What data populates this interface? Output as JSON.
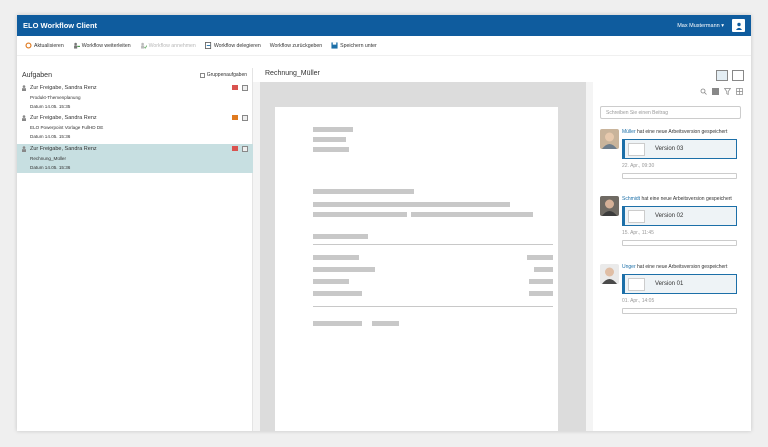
{
  "app": {
    "title": "ELO Workflow Client",
    "user": "Max Mustermann"
  },
  "toolbar": {
    "refresh": "Aktualisieren",
    "forward": "Workflow weiterleiten",
    "takeover": "Workflow annehmen",
    "delegate": "Workflow delegieren",
    "return": "Workflow zurückgeben",
    "save_as": "Speichern unter"
  },
  "tasks_panel": {
    "title": "Aufgaben",
    "group_tasks_label": "Gruppenaufgaben",
    "items": [
      {
        "title": "Zur Freigabe, Sandra Renz",
        "document": "Produkt-Themenplanung",
        "date": "Datum 14.05. 15:35",
        "selected": false
      },
      {
        "title": "Zur Freigabe, Sandra Renz",
        "document": "ELO Powerpoint Vorlage FullHD DE",
        "date": "Datum 14.05. 15:36",
        "selected": false
      },
      {
        "title": "Zur Freigabe, Sandra Renz",
        "document": "Rechnung_Müller",
        "date": "Datum 14.05. 15:36",
        "selected": true
      }
    ]
  },
  "viewer": {
    "document_title": "Rechnung_Müller"
  },
  "feed": {
    "input_placeholder": "Schreiben Sie einen Beitrag",
    "posts": [
      {
        "name": "Müller",
        "message": "hat eine neue Arbeitsversion gespeichert",
        "version": "Version 03",
        "date": "22. Apr., 09:30"
      },
      {
        "name": "Schmidt",
        "message": "hat eine neue Arbeitsversion gespeichert",
        "version": "Version 02",
        "date": "15. Apr., 11:45"
      },
      {
        "name": "Unger",
        "message": "hat eine neue Arbeitsversion gespeichert",
        "version": "Version 01",
        "date": "01. Apr., 14:05"
      }
    ]
  },
  "colors": {
    "titlebar": "#0f5c9e",
    "selection": "#c7dfe1",
    "link": "#1c6fa8"
  }
}
